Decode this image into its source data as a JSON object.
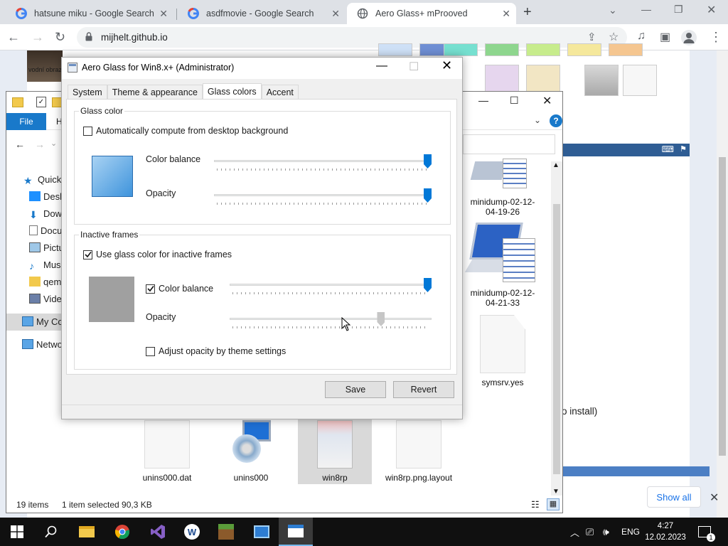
{
  "browser": {
    "tabs": [
      {
        "title": "hatsune miku - Google Search"
      },
      {
        "title": "asdfmovie - Google Search"
      },
      {
        "title": "Aero Glass+ mProoved",
        "active": true
      }
    ],
    "url": "mijhelt.github.io"
  },
  "page": {
    "left_text": "vodní obraz",
    "install_text": "o install)",
    "show_all": "Show all"
  },
  "explorer": {
    "ribbon_file": "File",
    "ribbon_home_partial": "H",
    "nav_items": [
      "Quick",
      "Desk",
      "Dow",
      "Docu",
      "Pictu",
      "Musi",
      "qem",
      "Vide",
      "My Co",
      "Netwo"
    ],
    "files": [
      {
        "name": "minidump-02-12-04-19-26"
      },
      {
        "name": "minidump-02-12-04-21-33"
      },
      {
        "name": "symsrv.yes"
      },
      {
        "name": "unins000.dat"
      },
      {
        "name": "unins000"
      },
      {
        "name": "win8rp"
      },
      {
        "name": "win8rp.png.layout"
      }
    ],
    "status_items": "19 items",
    "status_selected": "1 item selected  90,3 KB"
  },
  "dialog": {
    "title": "Aero Glass for Win8.x+ (Administrator)",
    "tabs": [
      "System",
      "Theme & appearance",
      "Glass colors",
      "Accent"
    ],
    "active_tab": "Glass colors",
    "glass_color": {
      "group_label": "Glass color",
      "auto_compute_label": "Automatically compute from desktop background",
      "auto_compute_checked": false,
      "color_balance_label": "Color balance",
      "color_balance_value": 1.0,
      "opacity_label": "Opacity",
      "opacity_value": 1.0,
      "preview_color": "#3f94dc"
    },
    "inactive_frames": {
      "group_label": "Inactive frames",
      "use_glass_label": "Use glass color for inactive frames",
      "use_glass_checked": true,
      "color_balance_label": "Color balance",
      "color_balance_checked": true,
      "color_balance_value": 1.0,
      "opacity_label": "Opacity",
      "opacity_value": 0.76,
      "adjust_opacity_label": "Adjust opacity by theme settings",
      "adjust_opacity_checked": false,
      "preview_color": "#a0a0a0"
    },
    "save_label": "Save",
    "revert_label": "Revert"
  },
  "taskbar": {
    "language": "ENG",
    "time": "4:27",
    "date": "12.02.2023",
    "notification_count": "1"
  },
  "colors": {
    "accent": "#0078d7",
    "file_tab": "#1979ca",
    "taskbar": "#101010"
  }
}
